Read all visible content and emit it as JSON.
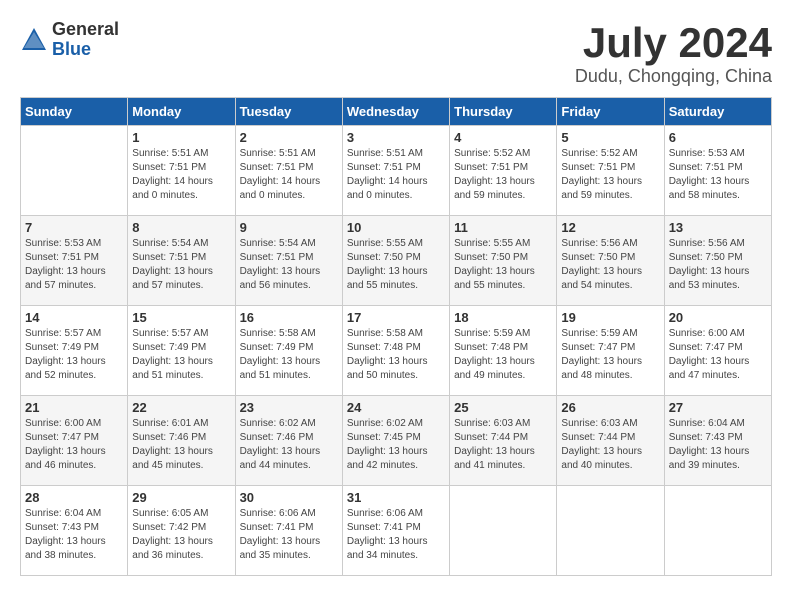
{
  "logo": {
    "general": "General",
    "blue": "Blue"
  },
  "title": "July 2024",
  "location": "Dudu, Chongqing, China",
  "weekdays": [
    "Sunday",
    "Monday",
    "Tuesday",
    "Wednesday",
    "Thursday",
    "Friday",
    "Saturday"
  ],
  "weeks": [
    [
      {
        "day": "",
        "info": ""
      },
      {
        "day": "1",
        "info": "Sunrise: 5:51 AM\nSunset: 7:51 PM\nDaylight: 14 hours\nand 0 minutes."
      },
      {
        "day": "2",
        "info": "Sunrise: 5:51 AM\nSunset: 7:51 PM\nDaylight: 14 hours\nand 0 minutes."
      },
      {
        "day": "3",
        "info": "Sunrise: 5:51 AM\nSunset: 7:51 PM\nDaylight: 14 hours\nand 0 minutes."
      },
      {
        "day": "4",
        "info": "Sunrise: 5:52 AM\nSunset: 7:51 PM\nDaylight: 13 hours\nand 59 minutes."
      },
      {
        "day": "5",
        "info": "Sunrise: 5:52 AM\nSunset: 7:51 PM\nDaylight: 13 hours\nand 59 minutes."
      },
      {
        "day": "6",
        "info": "Sunrise: 5:53 AM\nSunset: 7:51 PM\nDaylight: 13 hours\nand 58 minutes."
      }
    ],
    [
      {
        "day": "7",
        "info": "Sunrise: 5:53 AM\nSunset: 7:51 PM\nDaylight: 13 hours\nand 57 minutes."
      },
      {
        "day": "8",
        "info": "Sunrise: 5:54 AM\nSunset: 7:51 PM\nDaylight: 13 hours\nand 57 minutes."
      },
      {
        "day": "9",
        "info": "Sunrise: 5:54 AM\nSunset: 7:51 PM\nDaylight: 13 hours\nand 56 minutes."
      },
      {
        "day": "10",
        "info": "Sunrise: 5:55 AM\nSunset: 7:50 PM\nDaylight: 13 hours\nand 55 minutes."
      },
      {
        "day": "11",
        "info": "Sunrise: 5:55 AM\nSunset: 7:50 PM\nDaylight: 13 hours\nand 55 minutes."
      },
      {
        "day": "12",
        "info": "Sunrise: 5:56 AM\nSunset: 7:50 PM\nDaylight: 13 hours\nand 54 minutes."
      },
      {
        "day": "13",
        "info": "Sunrise: 5:56 AM\nSunset: 7:50 PM\nDaylight: 13 hours\nand 53 minutes."
      }
    ],
    [
      {
        "day": "14",
        "info": "Sunrise: 5:57 AM\nSunset: 7:49 PM\nDaylight: 13 hours\nand 52 minutes."
      },
      {
        "day": "15",
        "info": "Sunrise: 5:57 AM\nSunset: 7:49 PM\nDaylight: 13 hours\nand 51 minutes."
      },
      {
        "day": "16",
        "info": "Sunrise: 5:58 AM\nSunset: 7:49 PM\nDaylight: 13 hours\nand 51 minutes."
      },
      {
        "day": "17",
        "info": "Sunrise: 5:58 AM\nSunset: 7:48 PM\nDaylight: 13 hours\nand 50 minutes."
      },
      {
        "day": "18",
        "info": "Sunrise: 5:59 AM\nSunset: 7:48 PM\nDaylight: 13 hours\nand 49 minutes."
      },
      {
        "day": "19",
        "info": "Sunrise: 5:59 AM\nSunset: 7:47 PM\nDaylight: 13 hours\nand 48 minutes."
      },
      {
        "day": "20",
        "info": "Sunrise: 6:00 AM\nSunset: 7:47 PM\nDaylight: 13 hours\nand 47 minutes."
      }
    ],
    [
      {
        "day": "21",
        "info": "Sunrise: 6:00 AM\nSunset: 7:47 PM\nDaylight: 13 hours\nand 46 minutes."
      },
      {
        "day": "22",
        "info": "Sunrise: 6:01 AM\nSunset: 7:46 PM\nDaylight: 13 hours\nand 45 minutes."
      },
      {
        "day": "23",
        "info": "Sunrise: 6:02 AM\nSunset: 7:46 PM\nDaylight: 13 hours\nand 44 minutes."
      },
      {
        "day": "24",
        "info": "Sunrise: 6:02 AM\nSunset: 7:45 PM\nDaylight: 13 hours\nand 42 minutes."
      },
      {
        "day": "25",
        "info": "Sunrise: 6:03 AM\nSunset: 7:44 PM\nDaylight: 13 hours\nand 41 minutes."
      },
      {
        "day": "26",
        "info": "Sunrise: 6:03 AM\nSunset: 7:44 PM\nDaylight: 13 hours\nand 40 minutes."
      },
      {
        "day": "27",
        "info": "Sunrise: 6:04 AM\nSunset: 7:43 PM\nDaylight: 13 hours\nand 39 minutes."
      }
    ],
    [
      {
        "day": "28",
        "info": "Sunrise: 6:04 AM\nSunset: 7:43 PM\nDaylight: 13 hours\nand 38 minutes."
      },
      {
        "day": "29",
        "info": "Sunrise: 6:05 AM\nSunset: 7:42 PM\nDaylight: 13 hours\nand 36 minutes."
      },
      {
        "day": "30",
        "info": "Sunrise: 6:06 AM\nSunset: 7:41 PM\nDaylight: 13 hours\nand 35 minutes."
      },
      {
        "day": "31",
        "info": "Sunrise: 6:06 AM\nSunset: 7:41 PM\nDaylight: 13 hours\nand 34 minutes."
      },
      {
        "day": "",
        "info": ""
      },
      {
        "day": "",
        "info": ""
      },
      {
        "day": "",
        "info": ""
      }
    ]
  ]
}
